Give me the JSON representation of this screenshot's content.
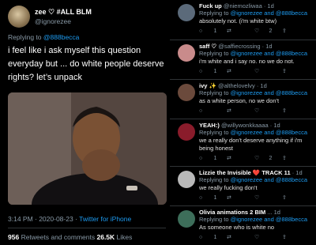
{
  "main": {
    "author": {
      "name": "zee ♡ #ALL BLM",
      "handle": "@ignorezee"
    },
    "replying_label": "Replying to",
    "replying_to": "@888becca",
    "text": "i feel like i ask myself this question everyday but ... do white people deserve rights? let’s unpack",
    "timestamp": "3:14 PM · 2020-08-23 · ",
    "client": "Twitter for iPhone",
    "retweets_count": "956",
    "retweets_label": "Retweets and comments",
    "likes_count": "26.5K",
    "likes_label": "Likes"
  },
  "replies": [
    {
      "name": "Fuck up",
      "handle": "@niemozliwaa · 1d",
      "replying_label": "Replying to",
      "mentions": "@ignorezee and @888becca",
      "text": "absolutely not. (i'm white btw)",
      "reply_count": "1",
      "retweet_count": "",
      "like_count": "2",
      "avatar_color": "#5b6a7a"
    },
    {
      "name": "saff ♡",
      "handle": "@saffiecrossing · 1d",
      "replying_label": "Replying to",
      "mentions": "@ignorezee and @888becca",
      "text": "i'm white and i say no. no we do not.",
      "reply_count": "1",
      "retweet_count": "",
      "like_count": "",
      "avatar_color": "#c98b8b"
    },
    {
      "name": "ivy ✨",
      "handle": "@althelovelvy · 1d",
      "replying_label": "Replying to",
      "mentions": "@ignorezee and @888becca",
      "text": "as a white person, no we don't",
      "reply_count": "",
      "retweet_count": "",
      "like_count": "",
      "avatar_color": "#6b4a3c"
    },
    {
      "name": "YEAH:)",
      "handle": "@willywonkkaaaa · 1d",
      "replying_label": "Replying to",
      "mentions": "@ignorezee and @888becca",
      "text": "we a really don't deserve anything if i'm being honest",
      "reply_count": "1",
      "retweet_count": "",
      "like_count": "2",
      "avatar_color": "#8a1c2b"
    },
    {
      "name": "Lizzie the Invisible ❤️ TRACK 11",
      "handle": " · 1d",
      "replying_label": "Replying to",
      "mentions": "@ignorezee and @888becca",
      "text": "we really fucking don't",
      "reply_count": "1",
      "retweet_count": "",
      "like_count": "",
      "avatar_color": "#b9b9b9"
    },
    {
      "name": "Olivia animations 2 BIM",
      "handle": " ... 1d",
      "replying_label": "Replying to",
      "mentions": "@ignorezee and @888becca",
      "text": "As someone who is white no",
      "reply_count": "1",
      "retweet_count": "",
      "like_count": "",
      "avatar_color": "#3d6e5a"
    }
  ]
}
